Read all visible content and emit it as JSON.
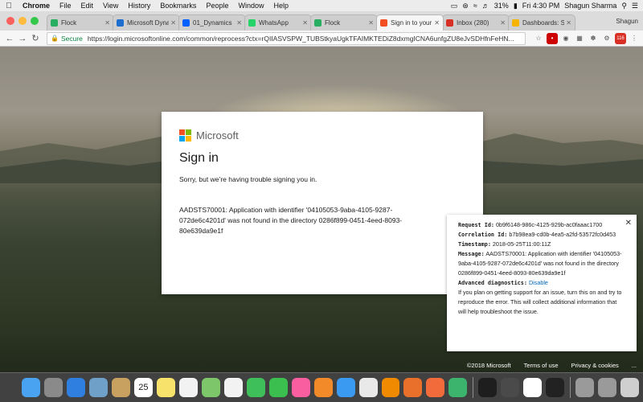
{
  "menubar": {
    "apple": "",
    "items": [
      "Chrome",
      "File",
      "Edit",
      "View",
      "History",
      "Bookmarks",
      "People",
      "Window",
      "Help"
    ],
    "battery": "31%",
    "clock": "Fri 4:30 PM",
    "user": "Shagun Sharma"
  },
  "tabs": [
    {
      "title": "Flock",
      "fav_color": "#27ae60",
      "active": false
    },
    {
      "title": "Microsoft Dyna",
      "fav_color": "#1e6ecf",
      "active": false
    },
    {
      "title": "01_Dynamics",
      "fav_color": "#0061fe",
      "active": false
    },
    {
      "title": "WhatsApp",
      "fav_color": "#25d366",
      "active": false
    },
    {
      "title": "Flock",
      "fav_color": "#27ae60",
      "active": false
    },
    {
      "title": "Sign in to your",
      "fav_color": "#f25022",
      "active": true
    },
    {
      "title": "Inbox (280)",
      "fav_color": "#d93025",
      "active": false
    },
    {
      "title": "Dashboards: S",
      "fav_color": "#f4b400",
      "active": false
    }
  ],
  "profile": "Shagun",
  "address": {
    "secure_label": "Secure",
    "url": "https://login.microsoftonline.com/common/reprocess?ctx=rQIIASVSPW_TUBStkyaUgkTFAIMKTEDiZ8dxmgICNA6unfgZU8eJvSDHfnFeHN..."
  },
  "card": {
    "brand": "Microsoft",
    "heading": "Sign in",
    "message": "Sorry, but we’re having trouble signing you in.",
    "error": "AADSTS70001: Application with identifier '04105053-9aba-4105-9287-072de6c4201d' was not found in the directory 0286f899-0451-4eed-8093-80e639da9e1f"
  },
  "details": {
    "request_label": "Request Id:",
    "request_value": "0b9f6148-986c-4125-929b-ac0faaac1700",
    "correlation_label": "Correlation Id:",
    "correlation_value": "b7b98ea9-cd0b-4ea5-a2fd-53572fc0d453",
    "timestamp_label": "Timestamp:",
    "timestamp_value": "2018-05-25T11:00:11Z",
    "message_label": "Message:",
    "message_value": "AADSTS70001: Application with identifier '04105053-9aba-4105-9287-072de6c4201d' was not found in the directory 0286f899-0451-4eed-8093-80e639da9e1f",
    "advanced_label": "Advanced diagnostics:",
    "advanced_link": "Disable",
    "advanced_note": "If you plan on getting support for an issue, turn this on and try to reproduce the error. This will collect additional information that will help troubleshoot the issue."
  },
  "footer": {
    "copyright": "©2018 Microsoft",
    "terms": "Terms of use",
    "privacy": "Privacy & cookies",
    "more": "..."
  },
  "dock": {
    "calendar_day": "25",
    "apps": [
      "finder",
      "launchpad",
      "safari",
      "preview",
      "contacts",
      "calendar",
      "notes",
      "reminders",
      "maps",
      "photos",
      "messages",
      "facetime",
      "itunes",
      "ibooks",
      "app-store",
      "chrome",
      "vlc",
      "firefox",
      "postman",
      "flock",
      "terminal",
      "sublime",
      "slack",
      "cortana"
    ]
  },
  "colors": {
    "ms_red": "#f25022",
    "ms_green": "#7fba00",
    "ms_blue": "#00a4ef",
    "ms_yellow": "#ffb900",
    "link": "#0067b8",
    "secure": "#0b8043"
  }
}
